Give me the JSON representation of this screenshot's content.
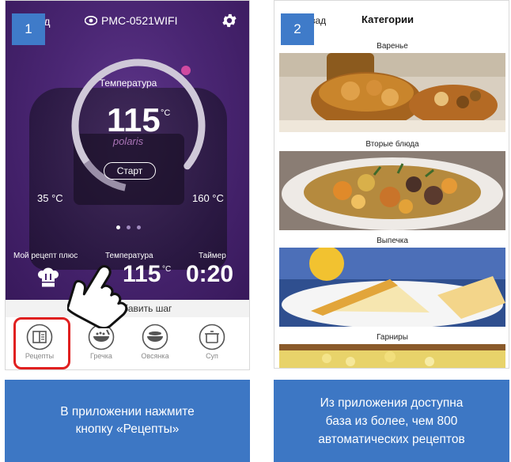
{
  "panel1": {
    "step_number": "1",
    "header": {
      "back_label": "зад",
      "device_name": "PMC-0521WIFI"
    },
    "dial": {
      "label": "Температура",
      "value": "115",
      "unit": "°C",
      "brand": "polaris",
      "start_label": "Старт",
      "min_temp": "35 °C",
      "max_temp": "160 °C"
    },
    "stats": {
      "my_recipe_label": "Мой рецепт плюс",
      "temp_label": "Температура",
      "temp_value": "115",
      "temp_unit": "°C",
      "timer_label": "Таймер",
      "timer_value": "0:20"
    },
    "add_step_label": "обавить шаг",
    "nav": [
      {
        "label": "Рецепты",
        "icon": "recipe-book-icon"
      },
      {
        "label": "Гречка",
        "icon": "buckwheat-bowl-icon"
      },
      {
        "label": "Овсянка",
        "icon": "oatmeal-bowl-icon"
      },
      {
        "label": "Суп",
        "icon": "soup-pot-icon"
      }
    ],
    "caption": "В приложении нажмите\nкнопку «Рецепты»"
  },
  "panel2": {
    "step_number": "2",
    "header": {
      "back_label": "зад",
      "title": "Категории"
    },
    "categories": [
      {
        "label": "Варенье"
      },
      {
        "label": "Вторые блюда"
      },
      {
        "label": "Выпечка"
      },
      {
        "label": "Гарниры"
      }
    ],
    "caption": "Из приложения доступна\nбаза из более, чем 800\nавтоматических рецептов"
  },
  "colors": {
    "purple_bg": "#4a2673",
    "badge_blue": "#3f7bc9",
    "caption_blue": "#3d77c4",
    "highlight_red": "#e02020",
    "dial_accent": "#d04aa0"
  }
}
